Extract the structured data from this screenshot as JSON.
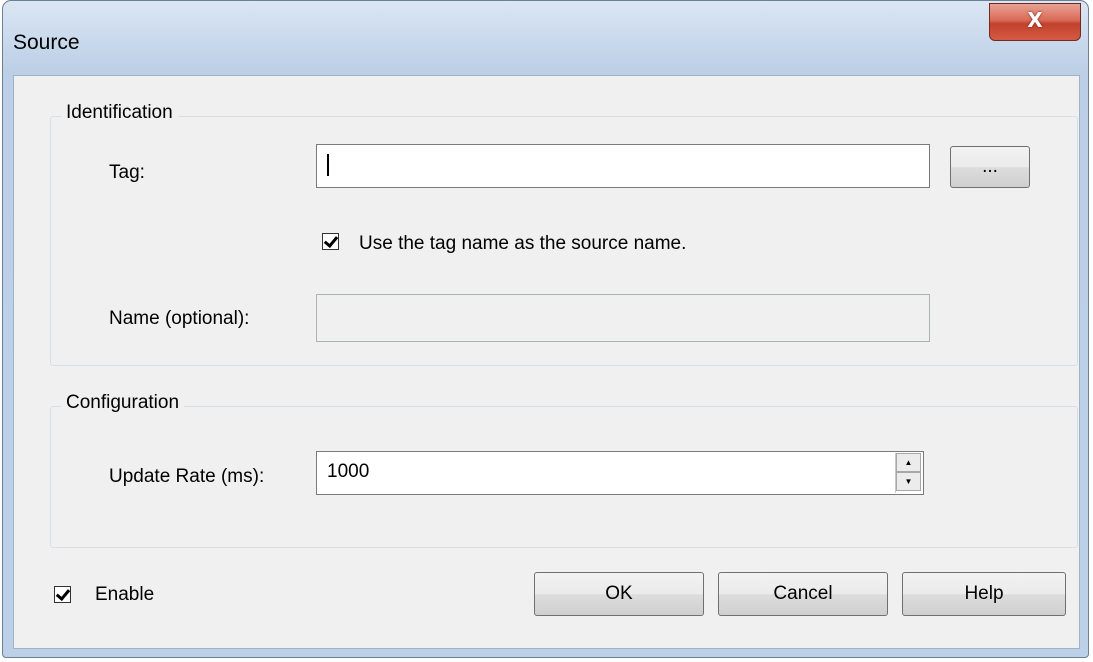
{
  "window": {
    "title": "Source",
    "close_label": "X"
  },
  "identification": {
    "legend": "Identification",
    "tag_label": "Tag:",
    "tag_value": "",
    "browse_label": "...",
    "use_tag_name_label": "Use the tag name as the source name.",
    "use_tag_name_checked": true,
    "name_label": "Name (optional):",
    "name_value": ""
  },
  "configuration": {
    "legend": "Configuration",
    "update_rate_label": "Update Rate (ms):",
    "update_rate_value": "1000"
  },
  "footer": {
    "enable_label": "Enable",
    "enable_checked": true,
    "ok_label": "OK",
    "cancel_label": "Cancel",
    "help_label": "Help"
  },
  "icons": {
    "close": "close-icon",
    "spin_up": "spin-up-icon",
    "spin_down": "spin-down-icon",
    "check": "checkmark-icon"
  }
}
